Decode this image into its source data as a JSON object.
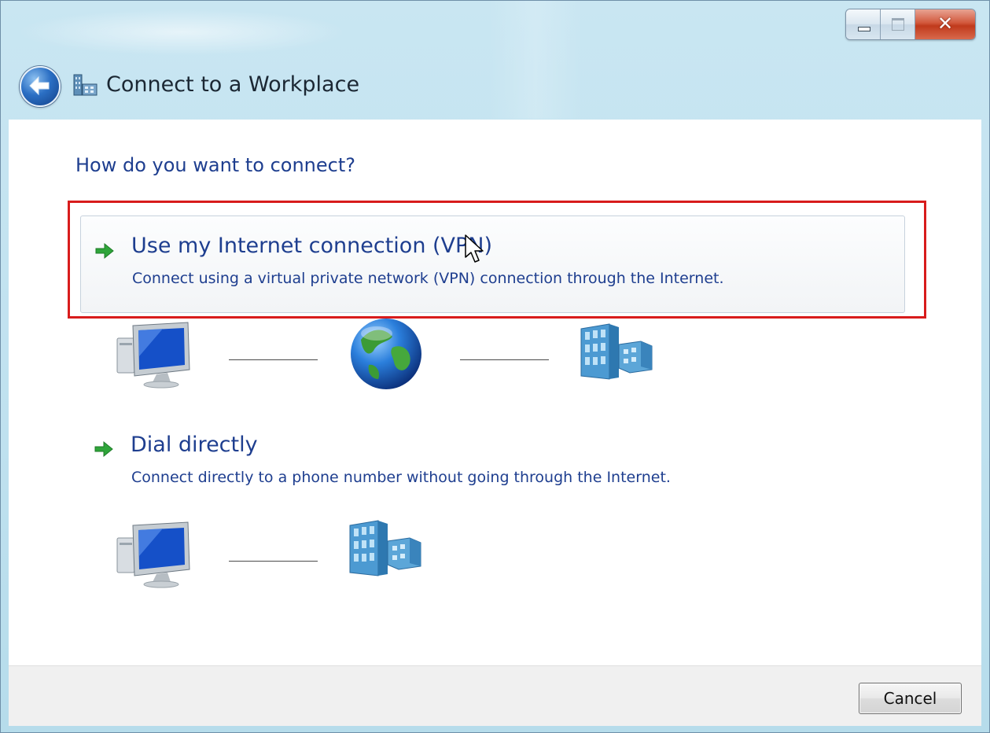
{
  "window": {
    "title": "Connect to a Workplace"
  },
  "content": {
    "heading": "How do you want to connect?",
    "options": [
      {
        "title": "Use my Internet connection (VPN)",
        "description": "Connect using a virtual private network (VPN) connection through the Internet.",
        "icons": [
          "computer-icon",
          "globe-icon",
          "workplace-building-icon"
        ]
      },
      {
        "title": "Dial directly",
        "description": "Connect directly to a phone number without going through the Internet.",
        "icons": [
          "computer-icon",
          "workplace-building-icon"
        ]
      }
    ]
  },
  "footer": {
    "cancel_label": "Cancel"
  },
  "colors": {
    "link_blue": "#1e3e8f",
    "highlight_red": "#d81c1c",
    "arrow_green": "#2fa53a",
    "titlebar": "#c9e6f2"
  }
}
